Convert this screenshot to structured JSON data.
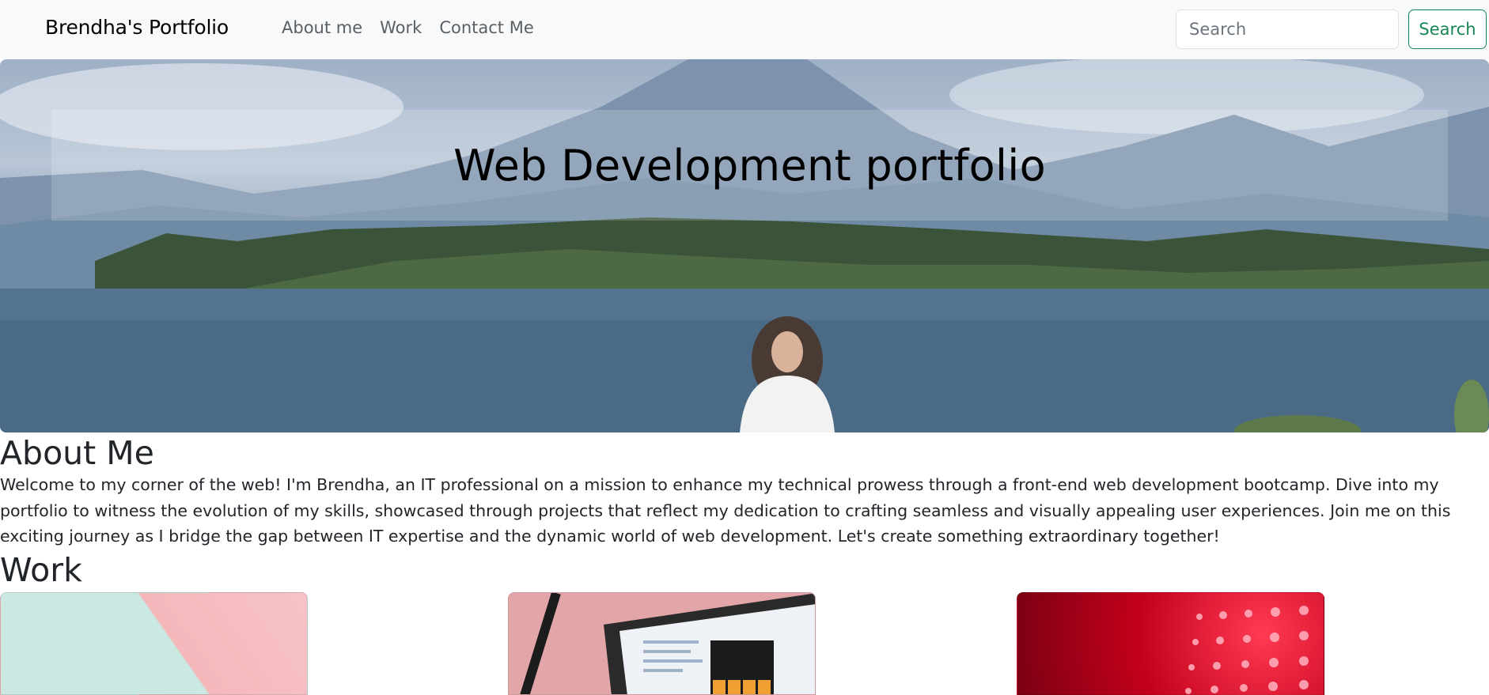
{
  "navbar": {
    "brand": "Brendha's Portfolio",
    "links": [
      "About me",
      "Work",
      "Contact Me"
    ],
    "search_placeholder": "Search",
    "search_button": "Search"
  },
  "hero": {
    "title": "Web Development portfolio"
  },
  "about": {
    "heading": "About Me",
    "text": "Welcome to my corner of the web! I'm Brendha, an IT professional on a mission to enhance my technical prowess through a front-end web development bootcamp. Dive into my portfolio to witness the evolution of my skills, showcased through projects that reflect my dedication to crafting seamless and visually appealing user experiences. Join me on this exciting journey as I bridge the gap between IT expertise and the dynamic world of web development. Let's create something extraordinary together!"
  },
  "work": {
    "heading": "Work"
  },
  "icons": [
    "calculator-screen-icon"
  ],
  "colors": {
    "navbar_bg": "#f8f9fa",
    "search_button": "#198754",
    "text": "#212529"
  }
}
